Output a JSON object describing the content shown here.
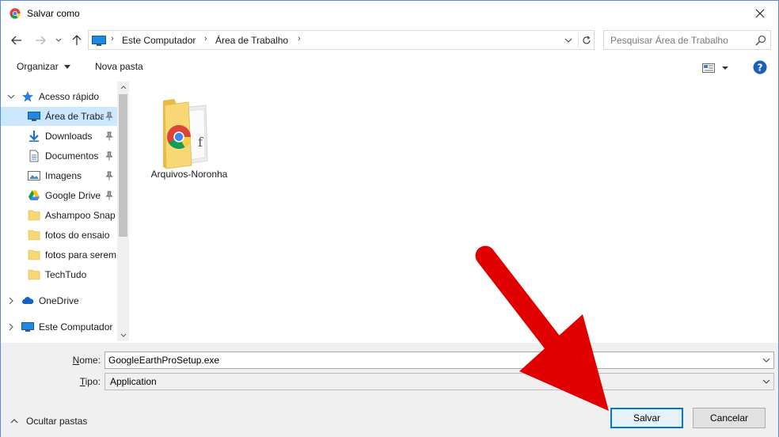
{
  "window": {
    "title": "Salvar como"
  },
  "navigation": {
    "breadcrumbs": [
      "Este Computador",
      "Área de Trabalho"
    ],
    "search_placeholder": "Pesquisar Área de Trabalho"
  },
  "toolbar": {
    "organize_label": "Organizar",
    "new_folder_label": "Nova pasta"
  },
  "sidebar": {
    "items": [
      {
        "label": "Acesso rápido",
        "icon": "star-icon",
        "expanded": true
      },
      {
        "label": "Área de Trabalho",
        "icon": "desktop-icon",
        "pinned": true,
        "selected": true
      },
      {
        "label": "Downloads",
        "icon": "download-icon",
        "pinned": true
      },
      {
        "label": "Documentos",
        "icon": "document-icon",
        "pinned": true
      },
      {
        "label": "Imagens",
        "icon": "image-icon",
        "pinned": true
      },
      {
        "label": "Google Drive",
        "icon": "google-drive-icon",
        "pinned": true
      },
      {
        "label": "Ashampoo Snap",
        "icon": "folder-icon"
      },
      {
        "label": "fotos do ensaio",
        "icon": "folder-icon"
      },
      {
        "label": "fotos para serem",
        "icon": "folder-icon"
      },
      {
        "label": "TechTudo",
        "icon": "folder-icon"
      },
      {
        "label": "OneDrive",
        "icon": "cloud-icon"
      },
      {
        "label": "Este Computador",
        "icon": "computer-icon"
      }
    ]
  },
  "files": [
    {
      "name": "Arquivos-Noronha",
      "icon": "chrome-folder-icon"
    }
  ],
  "form": {
    "name_label": "Nome:",
    "name_value": "GoogleEarthProSetup.exe",
    "type_label": "Tipo:",
    "type_value": "Application"
  },
  "footer": {
    "hide_folders_label": "Ocultar pastas",
    "save_label": "Salvar",
    "cancel_label": "Cancelar"
  },
  "colors": {
    "accent": "#0078d7",
    "selection": "#cce8ff",
    "annotation_arrow": "#e00000",
    "folder": "#f8d775"
  }
}
